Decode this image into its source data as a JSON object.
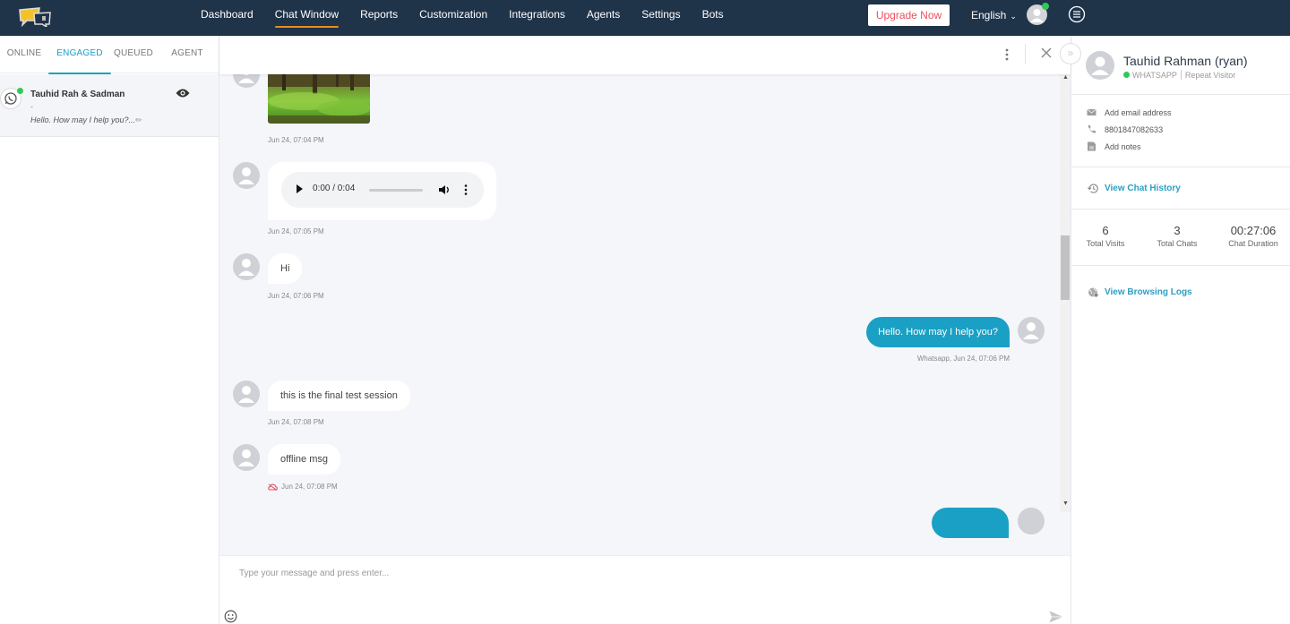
{
  "topbar": {
    "logo": "livechat-logo",
    "nav": [
      {
        "label": "Dashboard",
        "active": false
      },
      {
        "label": "Chat Window",
        "active": true
      },
      {
        "label": "Reports",
        "active": false
      },
      {
        "label": "Customization",
        "active": false
      },
      {
        "label": "Integrations",
        "active": false
      },
      {
        "label": "Agents",
        "active": false
      },
      {
        "label": "Settings",
        "active": false
      },
      {
        "label": "Bots",
        "active": false
      }
    ],
    "upgrade_label": "Upgrade Now",
    "language": "English",
    "colors": {
      "background": "#1f3349",
      "active_underline": "#e88d19",
      "upgrade_text": "#ee4f5f",
      "online": "#2fc95a"
    }
  },
  "left_panel": {
    "tabs": [
      {
        "label": "ONLINE",
        "active": false
      },
      {
        "label": "ENGAGED",
        "active": true
      },
      {
        "label": "QUEUED",
        "active": false
      },
      {
        "label": "AGENT",
        "active": false
      }
    ],
    "conversations": [
      {
        "name": "Tauhid Rah & Sadman",
        "subline": "-",
        "preview": "Hello. How may I help you?...",
        "channel_icon": "whatsapp-icon",
        "online": true
      }
    ]
  },
  "chat": {
    "messages": [
      {
        "direction": "in",
        "type": "image",
        "alt": "forest image",
        "timestamp": "Jun 24, 07:04 PM"
      },
      {
        "direction": "in",
        "type": "audio",
        "audio_time": "0:00 / 0:04",
        "timestamp": "Jun 24, 07:05 PM"
      },
      {
        "direction": "in",
        "type": "text",
        "text": "Hi",
        "timestamp": "Jun 24, 07:06 PM"
      },
      {
        "direction": "out",
        "type": "text",
        "text": "Hello. How may I help you?",
        "timestamp": "Whatsapp, Jun 24, 07:06 PM"
      },
      {
        "direction": "in",
        "type": "text",
        "text": "this is the final test session",
        "timestamp": "Jun 24, 07:08 PM"
      },
      {
        "direction": "in",
        "type": "text",
        "text": "offline msg",
        "timestamp": "Jun 24, 07:08 PM",
        "status_icon": "offline-cloud-icon"
      }
    ],
    "composer_placeholder": "Type your message and press enter...",
    "colors": {
      "outgoing_bubble": "#1aa0c4",
      "background": "#f4f6fa",
      "offline_icon": "#e0485a"
    }
  },
  "visitor": {
    "name": "Tauhid Rahman (ryan)",
    "channel": "WHATSAPP",
    "visitor_type": "Repeat Visitor",
    "email_placeholder": "Add email address",
    "phone": "8801847082633",
    "notes_placeholder": "Add notes",
    "view_history_label": "View Chat History",
    "stats": [
      {
        "value": "6",
        "label": "Total Visits"
      },
      {
        "value": "3",
        "label": "Total Chats"
      },
      {
        "value": "00:27:06",
        "label": "Chat Duration"
      }
    ],
    "view_logs_label": "View Browsing Logs",
    "link_color": "#2d9ec2"
  }
}
